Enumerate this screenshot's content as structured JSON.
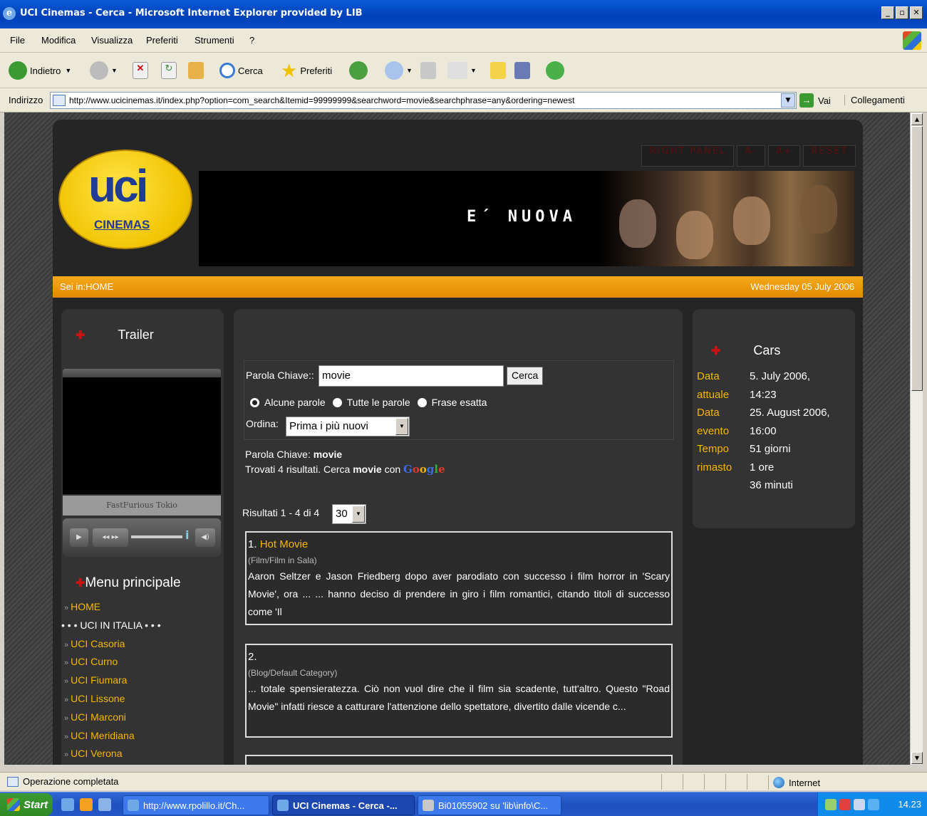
{
  "window": {
    "title": "UCI Cinemas - Cerca - Microsoft Internet Explorer provided by LIB",
    "min": "_",
    "max": "▫",
    "close": "✕"
  },
  "menubar": [
    "File",
    "Modifica",
    "Visualizza",
    "Preferiti",
    "Strumenti",
    "?"
  ],
  "toolbar": {
    "back": "Indietro",
    "search": "Cerca",
    "favorites": "Preferiti"
  },
  "address": {
    "label": "Indirizzo",
    "url": "http://www.ucicinemas.it/index.php?option=com_search&Itemid=99999999&searchword=movie&searchphrase=any&ordering=newest",
    "go": "Vai",
    "links": "Collegamenti"
  },
  "site": {
    "logo_text": "UCI",
    "logo_sub": "CINEMAS",
    "top_buttons": [
      "RIGHT PANEL",
      "A-",
      "A+",
      "RESET"
    ],
    "banner_text": "E´ NUOVA",
    "breadcrumb": "Sei in:HOME",
    "date": "Wednesday 05 July 2006"
  },
  "left": {
    "trailer_title": "Trailer",
    "player_caption": "FastFurious Tokio",
    "player_icons": [
      "play-icon",
      "rewind-icon",
      "forward-icon",
      "info-icon",
      "volume-icon"
    ],
    "menu_title": "Menu principale",
    "menu_items": [
      {
        "label": "HOME",
        "link": true
      },
      {
        "label": "• • • UCI IN ITALIA • • •",
        "link": false
      },
      {
        "label": "UCI Casoria",
        "link": true
      },
      {
        "label": "UCI Curno",
        "link": true
      },
      {
        "label": "UCI Fiumara",
        "link": true
      },
      {
        "label": "UCI Lissone",
        "link": true
      },
      {
        "label": "UCI Marconi",
        "link": true
      },
      {
        "label": "UCI Meridiana",
        "link": true
      },
      {
        "label": "UCI Verona",
        "link": true
      }
    ]
  },
  "search": {
    "keyword_label": "Parola Chiave::",
    "keyword_value": "movie",
    "button": "Cerca",
    "options": [
      {
        "label": "Alcune parole",
        "selected": true
      },
      {
        "label": "Tutte le parole",
        "selected": false
      },
      {
        "label": "Frase esatta",
        "selected": false
      }
    ],
    "order_label": "Ordina:",
    "order_value": "Prima i più nuovi",
    "summary_kw_label": "Parola Chiave:",
    "summary_kw": "movie",
    "found_prefix": "Trovati 4 risultati. Cerca",
    "found_kw": "movie",
    "found_with": "con",
    "google": "Google",
    "results_range": "Risultati 1 - 4 di 4",
    "per_page": "30"
  },
  "results": [
    {
      "num": "1.",
      "title": "Hot Movie",
      "category": "(Film/Film in Sala)",
      "excerpt": "Aaron Seltzer e Jason Friedberg dopo aver parodiato con successo i film horror in 'Scary Movie', ora ... ... hanno deciso di prendere in giro i film romantici, citando titoli di successo come 'Il"
    },
    {
      "num": "2.",
      "title": "",
      "category": "(Blog/Default Category)",
      "excerpt": "... totale spensieratezza. Ciò non vuol dire che il film sia scadente, tutt'altro. Questo \"Road Movie\" infatti riesce a catturare l'attenzione dello spettatore, divertito dalle vicende c..."
    }
  ],
  "countdown": {
    "title": "Cars",
    "rows": [
      {
        "k": "Data",
        "v": "5. July 2006,"
      },
      {
        "k": "attuale",
        "v": "14:23"
      },
      {
        "k": "Data",
        "v": "25. August 2006,"
      },
      {
        "k": "evento",
        "v": "16:00"
      },
      {
        "k": "Tempo",
        "v": "51 giorni"
      },
      {
        "k": "rimasto",
        "v": "1 ore"
      },
      {
        "k": "",
        "v": "36 minuti"
      }
    ]
  },
  "status": {
    "text": "Operazione completata",
    "zone": "Internet"
  },
  "taskbar": {
    "start": "Start",
    "tasks": [
      {
        "label": "http://www.rpolillo.it/Ch...",
        "active": false
      },
      {
        "label": "UCI Cinemas - Cerca -...",
        "active": true
      },
      {
        "label": "Bi01055902 su 'lib\\info\\C...",
        "active": false
      }
    ],
    "clock": "14.23"
  }
}
